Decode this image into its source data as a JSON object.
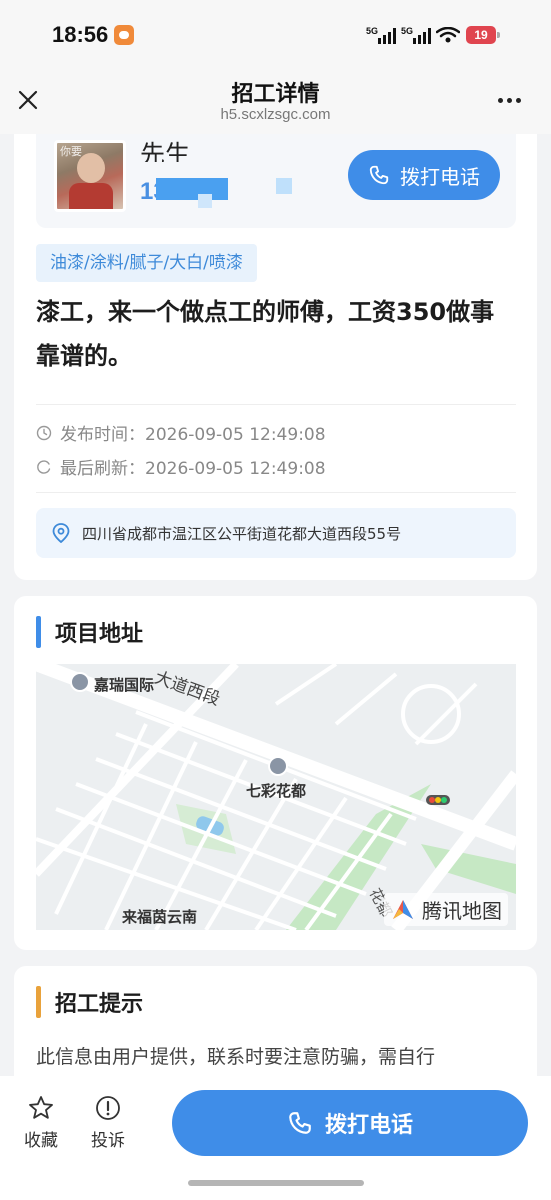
{
  "status_bar": {
    "time": "18:56",
    "network_1": "5G",
    "network_2": "5G",
    "battery": "19"
  },
  "nav": {
    "title": "招工详情",
    "url": "h5.scxlzsgc.com",
    "close_icon": "close-icon",
    "more_icon": "more-icon"
  },
  "contact": {
    "avatar_caption": "你要",
    "name": "先生",
    "phone": "13",
    "call_label": "拨打电话"
  },
  "job": {
    "tag": "油漆/涂料/腻子/大白/喷漆",
    "title": "漆工，来一个做点工的师傅，工资350做事靠谱的。",
    "publish_time": "发布时间：2026-09-05 12:49:08",
    "refresh_time": "最后刷新：2026-09-05 12:49:08",
    "address": "四川省成都市温江区公平街道花都大道西段55号"
  },
  "project_address": {
    "heading": "项目地址",
    "heading_color": "#3f8de8",
    "map": {
      "road_label": "大道西段",
      "poi_1": "嘉瑞国际",
      "poi_2": "七彩花都",
      "poi_3": "来福茵云南",
      "road_label_2": "花都",
      "provider": "腾讯地图"
    }
  },
  "tips": {
    "heading": "招工提示",
    "heading_color": "#e9a23b",
    "text": "此信息由用户提供，联系时要注意防骗，需自行"
  },
  "bottom_bar": {
    "favorite_label": "收藏",
    "favorite_icon": "star-icon",
    "report_label": "投诉",
    "report_icon": "alert-circle-icon",
    "call_label": "拨打电话"
  },
  "colors": {
    "accent": "#3f8de8",
    "tag_bg": "#e8f2fc",
    "tag_text": "#3e8ad9"
  }
}
